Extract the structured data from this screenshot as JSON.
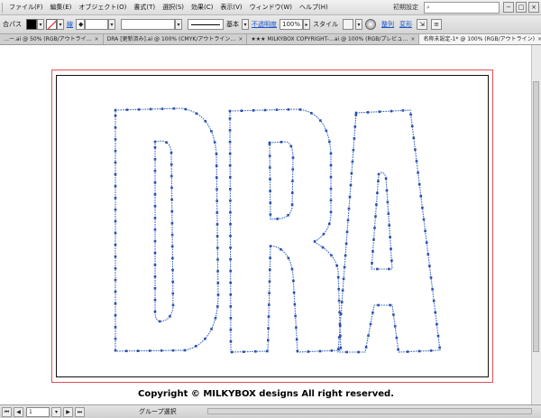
{
  "menubar": {
    "items": [
      {
        "label": "ファイル(F)"
      },
      {
        "label": "編集(E)"
      },
      {
        "label": "オブジェクト(O)"
      },
      {
        "label": "書式(T)"
      },
      {
        "label": "選択(S)"
      },
      {
        "label": "効果(C)"
      },
      {
        "label": "表示(V)"
      },
      {
        "label": "ウィンドウ(W)"
      },
      {
        "label": "ヘルプ(H)"
      }
    ],
    "workspace_label": "初期設定",
    "search_placeholder": "",
    "window_buttons": [
      "−",
      "□",
      "×"
    ]
  },
  "controlbar": {
    "selection_label": "合パス",
    "stroke_label": "線",
    "stroke_weight": "",
    "brush_label": "基本",
    "opacity_label": "不透明度",
    "opacity_value": "100%",
    "style_label": "スタイル",
    "align_label": "整列",
    "transform_label": "変形"
  },
  "tabs": [
    {
      "label": "…ー.ai @ 50% (RGB/アウトライ…",
      "active": false
    },
    {
      "label": "DRA [更新済み].ai @ 100% (CMYK/アウトライン…",
      "active": false
    },
    {
      "label": "★★★  MILKYBOX  COPYRIGHT-…ai @ 100% (RGB/プレビュ…",
      "active": false
    },
    {
      "label": "名称未設定-1* @ 100% (RGB/アウトライン)",
      "active": true
    }
  ],
  "artwork": {
    "text": "DRA",
    "path_color": "#3a68c8",
    "point_color": "#2a4fa8"
  },
  "copyright": "Copyright © MILKYBOX designs All right reserved.",
  "statusbar": {
    "page": "1",
    "status_text": "グループ選択"
  }
}
